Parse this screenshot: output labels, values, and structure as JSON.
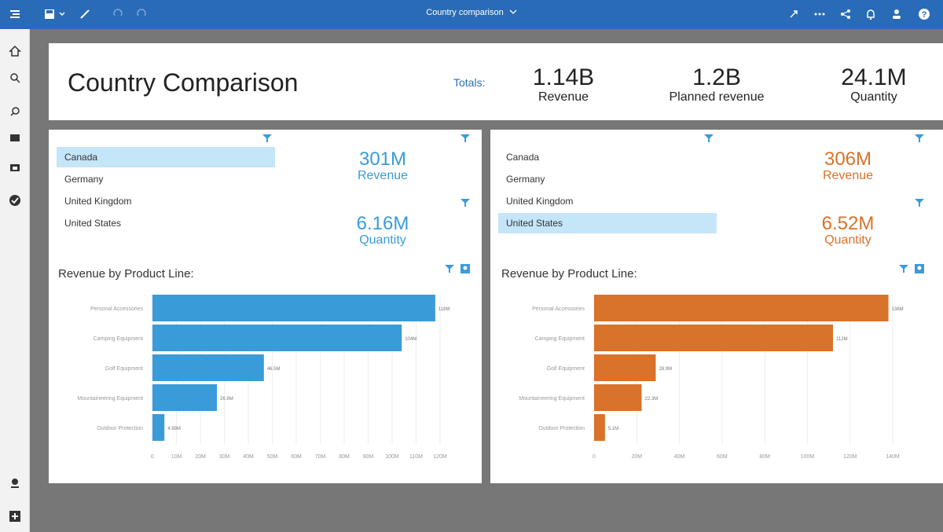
{
  "topbar": {
    "title": "Country comparison"
  },
  "header": {
    "title": "Country Comparison",
    "totals_label": "Totals:",
    "kpis": [
      {
        "value": "1.14B",
        "label": "Revenue"
      },
      {
        "value": "1.2B",
        "label": "Planned revenue"
      },
      {
        "value": "24.1M",
        "label": "Quantity"
      }
    ]
  },
  "left": {
    "countries": [
      "Canada",
      "Germany",
      "United Kingdom",
      "United States"
    ],
    "selected": 0,
    "revenue": {
      "value": "301M",
      "label": "Revenue"
    },
    "quantity": {
      "value": "6.16M",
      "label": "Quantity"
    },
    "chart_title": "Revenue by Product Line:"
  },
  "right": {
    "countries": [
      "Canada",
      "Germany",
      "United Kingdom",
      "United States"
    ],
    "selected": 3,
    "revenue": {
      "value": "306M",
      "label": "Revenue"
    },
    "quantity": {
      "value": "6.52M",
      "label": "Quantity"
    },
    "chart_title": "Revenue by Product Line:"
  },
  "chart_data": [
    {
      "type": "bar",
      "orientation": "horizontal",
      "color": "#3a9bd9",
      "categories": [
        "Personal Accessories",
        "Camping Equipment",
        "Golf Equipment",
        "Mountaineering Equipment",
        "Outdoor Protection"
      ],
      "values": [
        118,
        104,
        46.5,
        26.9,
        4.99
      ],
      "data_labels": [
        "118M",
        "104M",
        "46.5M",
        "26.9M",
        "4.99M"
      ],
      "xlim": [
        0,
        120
      ],
      "x_ticks": [
        "0",
        "10M",
        "20M",
        "30M",
        "40M",
        "50M",
        "60M",
        "70M",
        "80M",
        "90M",
        "100M",
        "110M",
        "120M"
      ],
      "x_tick_values": [
        0,
        10,
        20,
        30,
        40,
        50,
        60,
        70,
        80,
        90,
        100,
        110,
        120
      ],
      "grid": true
    },
    {
      "type": "bar",
      "orientation": "horizontal",
      "color": "#d9722a",
      "categories": [
        "Personal Accessories",
        "Camping Equipment",
        "Golf Equipment",
        "Mountaineering Equipment",
        "Outdoor Protection"
      ],
      "values": [
        138,
        112,
        28.9,
        22.3,
        5.1
      ],
      "data_labels": [
        "138M",
        "112M",
        "28.9M",
        "22.3M",
        "5.1M"
      ],
      "xlim": [
        0,
        140
      ],
      "x_ticks": [
        "0",
        "20M",
        "40M",
        "60M",
        "80M",
        "100M",
        "120M",
        "140M"
      ],
      "x_tick_values": [
        0,
        20,
        40,
        60,
        80,
        100,
        120,
        140
      ],
      "grid": true
    }
  ]
}
